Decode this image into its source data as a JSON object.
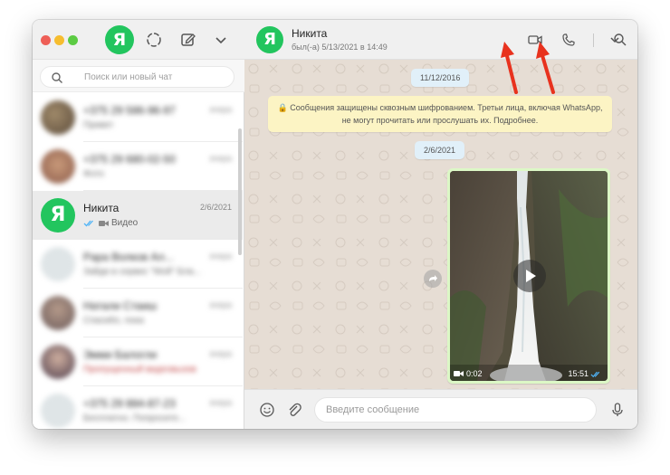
{
  "sidebar": {
    "search": {
      "placeholder": "Поиск или новый чат"
    },
    "chats": [
      {
        "name": "+375 29 586-96-97",
        "time": "вчера",
        "preview": "Привет"
      },
      {
        "name": "+375 29 680-02-50",
        "time": "вчера",
        "preview": "Фото"
      },
      {
        "name": "Никита",
        "time": "2/6/2021",
        "preview": "Видео"
      },
      {
        "name": "Papa Волков Ал...",
        "time": "вчера",
        "preview": "Зайди в сервис \"Мой\" Бла..."
      },
      {
        "name": "Натали Стаиш",
        "time": "вчера",
        "preview": "Спасибо, пока"
      },
      {
        "name": "Эмми Балогли",
        "time": "вчера",
        "preview": "Пропущенный видеовызов"
      },
      {
        "name": "+375 29 884-87-23",
        "time": "вчера",
        "preview": "Бесплатно. Попросите..."
      }
    ]
  },
  "header": {
    "contact_name": "Никита",
    "status": "был(-а) 5/13/2021 в 14:49"
  },
  "chat": {
    "date_1": "11/12/2016",
    "encryption_notice": "Сообщения защищены сквозным шифрованием. Третьи лица, включая WhatsApp, не могут прочитать или прослушать их. Подробнее.",
    "date_2": "2/6/2021",
    "video": {
      "duration": "0:02",
      "time": "15:51"
    }
  },
  "composer": {
    "placeholder": "Введите сообщение"
  },
  "colors": {
    "accent_green": "#22c55e",
    "arrow_red": "#e8321e",
    "chat_background": "#e6ddd4",
    "outgoing_bubble": "#dcf8c6",
    "notice_yellow": "#fcf4c4",
    "date_chip": "#e1f0f9"
  },
  "icons": {
    "avatar_letter": "Я"
  }
}
